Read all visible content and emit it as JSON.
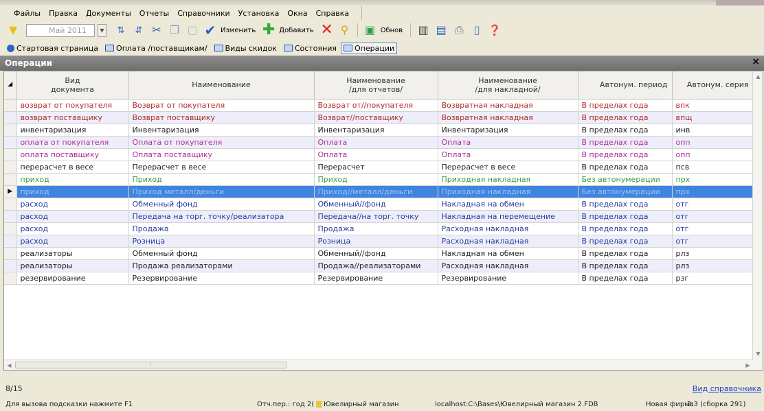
{
  "menu": [
    "Файлы",
    "Правка",
    "Документы",
    "Отчеты",
    "Справочники",
    "Установка",
    "Окна",
    "Справка"
  ],
  "toolbar": {
    "date_value": "Май 2011",
    "edit_label": "Изменить",
    "add_label": "Добавить",
    "refresh_label": "Обнов"
  },
  "tabs": [
    {
      "label": "Стартовая страница"
    },
    {
      "label": "Оплата /поставщикам/"
    },
    {
      "label": "Виды скидок"
    },
    {
      "label": "Состояния"
    },
    {
      "label": "Операции"
    }
  ],
  "panel": {
    "title": "Операции",
    "close": "×"
  },
  "columns": {
    "doc_type_1": "Вид",
    "doc_type_2": "документа",
    "name": "Наименование",
    "name_reports_1": "Наименование",
    "name_reports_2": "/для отчетов/",
    "name_invoice_1": "Наименование",
    "name_invoice_2": "/для накладной/",
    "auto_period": "Автонум. период",
    "auto_series": "Автонум. серия"
  },
  "rows": [
    {
      "doc": "возврат от покупателя",
      "name": "Возврат от покупателя",
      "rep": "Возврат от//покупателя",
      "inv": "Возвратная накладная",
      "period": "В пределах года",
      "series": "впк",
      "color": "c-red"
    },
    {
      "doc": "возврат поставщику",
      "name": "Возврат поставщику",
      "rep": "Возврат//поставщику",
      "inv": "Возвратная накладная",
      "period": "В пределах года",
      "series": "впщ",
      "color": "c-red"
    },
    {
      "doc": "инвентаризация",
      "name": "Инвентаризация",
      "rep": "Инвентаризация",
      "inv": "Инвентаризация",
      "period": "В пределах года",
      "series": "инв",
      "color": "c-dark"
    },
    {
      "doc": "оплата от покупателя",
      "name": "Оплата от покупателя",
      "rep": "Оплата",
      "inv": "Оплата",
      "period": "В пределах года",
      "series": "опп",
      "color": "c-mag"
    },
    {
      "doc": "оплата поставщику",
      "name": "Оплата поставщику",
      "rep": "Оплата",
      "inv": "Оплата",
      "period": "В пределах года",
      "series": "опп",
      "color": "c-mag"
    },
    {
      "doc": "перерасчет в весе",
      "name": "Перерасчет в весе",
      "rep": "Перерасчет",
      "inv": "Перерасчет в весе",
      "period": "В пределах года",
      "series": "псв",
      "color": "c-dark"
    },
    {
      "doc": "приход",
      "name": "Приход",
      "rep": "Приход",
      "inv": "Приходная накладная",
      "period": "Без автонумерации",
      "series": "прх",
      "color": "c-green"
    },
    {
      "doc": "приход",
      "name": "Приход металл/деньги",
      "rep": "Приход//металл/деньги",
      "inv": "Приходная накладная",
      "period": "Без автонумерации",
      "series": "прх",
      "color": "c-green"
    },
    {
      "doc": "расход",
      "name": "Обменный фонд",
      "rep": "Обменный//фонд",
      "inv": "Накладная на обмен",
      "period": "В пределах года",
      "series": "отг",
      "color": "c-blue"
    },
    {
      "doc": "расход",
      "name": "Передача на торг. точку/реализатора",
      "rep": "Передача//на торг. точку",
      "inv": "Накладная на перемещение",
      "period": "В пределах года",
      "series": "отг",
      "color": "c-blue"
    },
    {
      "doc": "расход",
      "name": "Продажа",
      "rep": "Продажа",
      "inv": "Расходная накладная",
      "period": "В пределах года",
      "series": "отг",
      "color": "c-blue"
    },
    {
      "doc": "расход",
      "name": "Розница",
      "rep": "Розница",
      "inv": "Расходная накладная",
      "period": "В пределах года",
      "series": "отг",
      "color": "c-blue"
    },
    {
      "doc": "реализаторы",
      "name": "Обменный фонд",
      "rep": "Обменный//фонд",
      "inv": "Накладная на обмен",
      "period": "В пределах года",
      "series": "рлз",
      "color": "c-dark"
    },
    {
      "doc": "реализаторы",
      "name": "Продажа реализаторами",
      "rep": "Продажа//реализаторами",
      "inv": "Расходная накладная",
      "period": "В пределах года",
      "series": "рлз",
      "color": "c-dark"
    },
    {
      "doc": "резервирование",
      "name": "Резервирование",
      "rep": "Резервирование",
      "inv": "Резервирование",
      "period": "В пределах года",
      "series": "рзг",
      "color": "c-dark"
    }
  ],
  "selected_row": 7,
  "footer": {
    "row_count": "8/15",
    "ref_link": "Вид справочника"
  },
  "status": {
    "hint": "Для вызова подсказки нажмите F1",
    "period": "Отч.пер.: год 2(",
    "shop": "Ювелирный магазин",
    "path": "localhost:C:\\Bases\\Ювелирный магазин 2.FDB",
    "firm": "Новая фирма",
    "version": "2.3 (сборка 291)"
  }
}
